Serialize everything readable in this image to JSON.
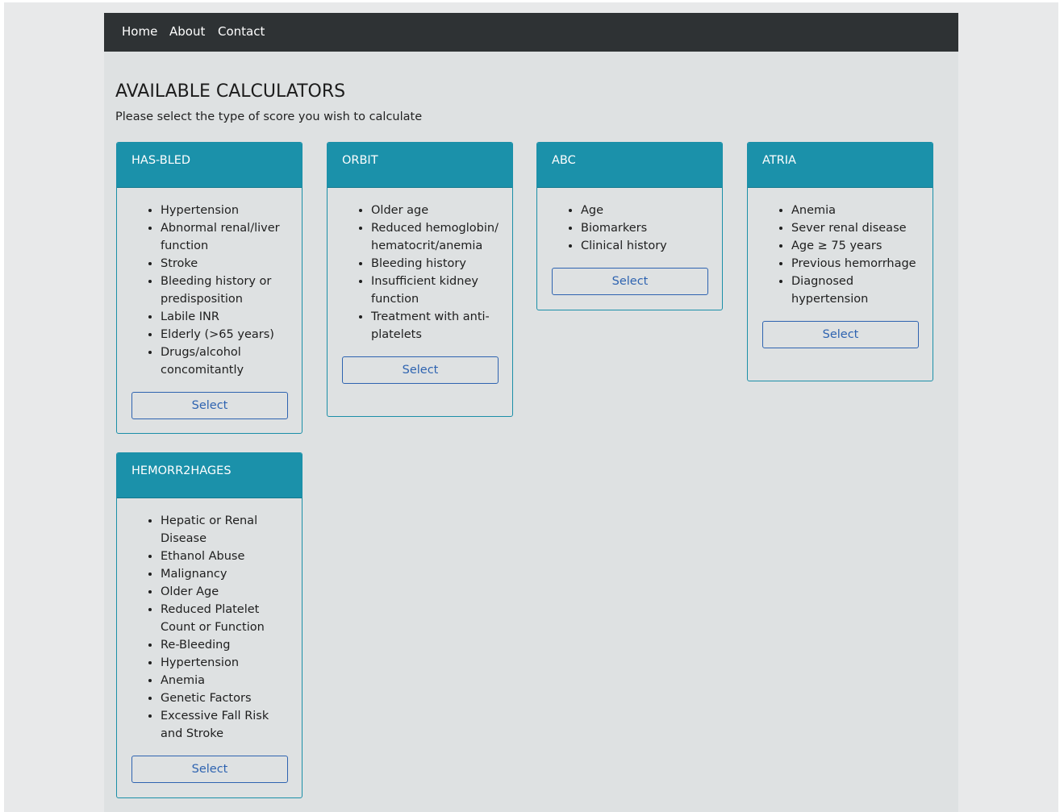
{
  "navbar": {
    "links": [
      {
        "label": "Home"
      },
      {
        "label": "About"
      },
      {
        "label": "Contact"
      }
    ]
  },
  "page": {
    "title": "AVAILABLE CALCULATORS",
    "subtitle": "Please select the type of score you wish to calculate"
  },
  "cards": [
    {
      "title": "HAS-BLED",
      "items": [
        "Hypertension",
        "Abnormal renal/liver function",
        "Stroke",
        "Bleeding history or predisposition",
        "Labile INR",
        "Elderly (>65 years)",
        "Drugs/alcohol concomitantly"
      ],
      "button_label": "Select"
    },
    {
      "title": "ORBIT",
      "items": [
        "Older age",
        "Reduced hemoglobin/hematocrit/anemia",
        "Bleeding history",
        "Insufficient kidney function",
        "Treatment with anti-platelets"
      ],
      "button_label": "Select"
    },
    {
      "title": "ABC",
      "items": [
        "Age",
        "Biomarkers",
        "Clinical history"
      ],
      "button_label": "Select"
    },
    {
      "title": "ATRIA",
      "items": [
        "Anemia",
        "Sever renal disease",
        "Age ≥ 75 years",
        "Previous hemorrhage",
        "Diagnosed hypertension"
      ],
      "button_label": "Select"
    },
    {
      "title": "HEMORR2HAGES",
      "items": [
        "Hepatic or Renal Disease",
        "Ethanol Abuse",
        "Malignancy",
        "Older Age",
        "Reduced Platelet Count or Function",
        "Re-Bleeding",
        "Hypertension",
        "Anemia",
        "Genetic Factors",
        "Excessive Fall Risk and Stroke"
      ],
      "button_label": "Select"
    }
  ]
}
